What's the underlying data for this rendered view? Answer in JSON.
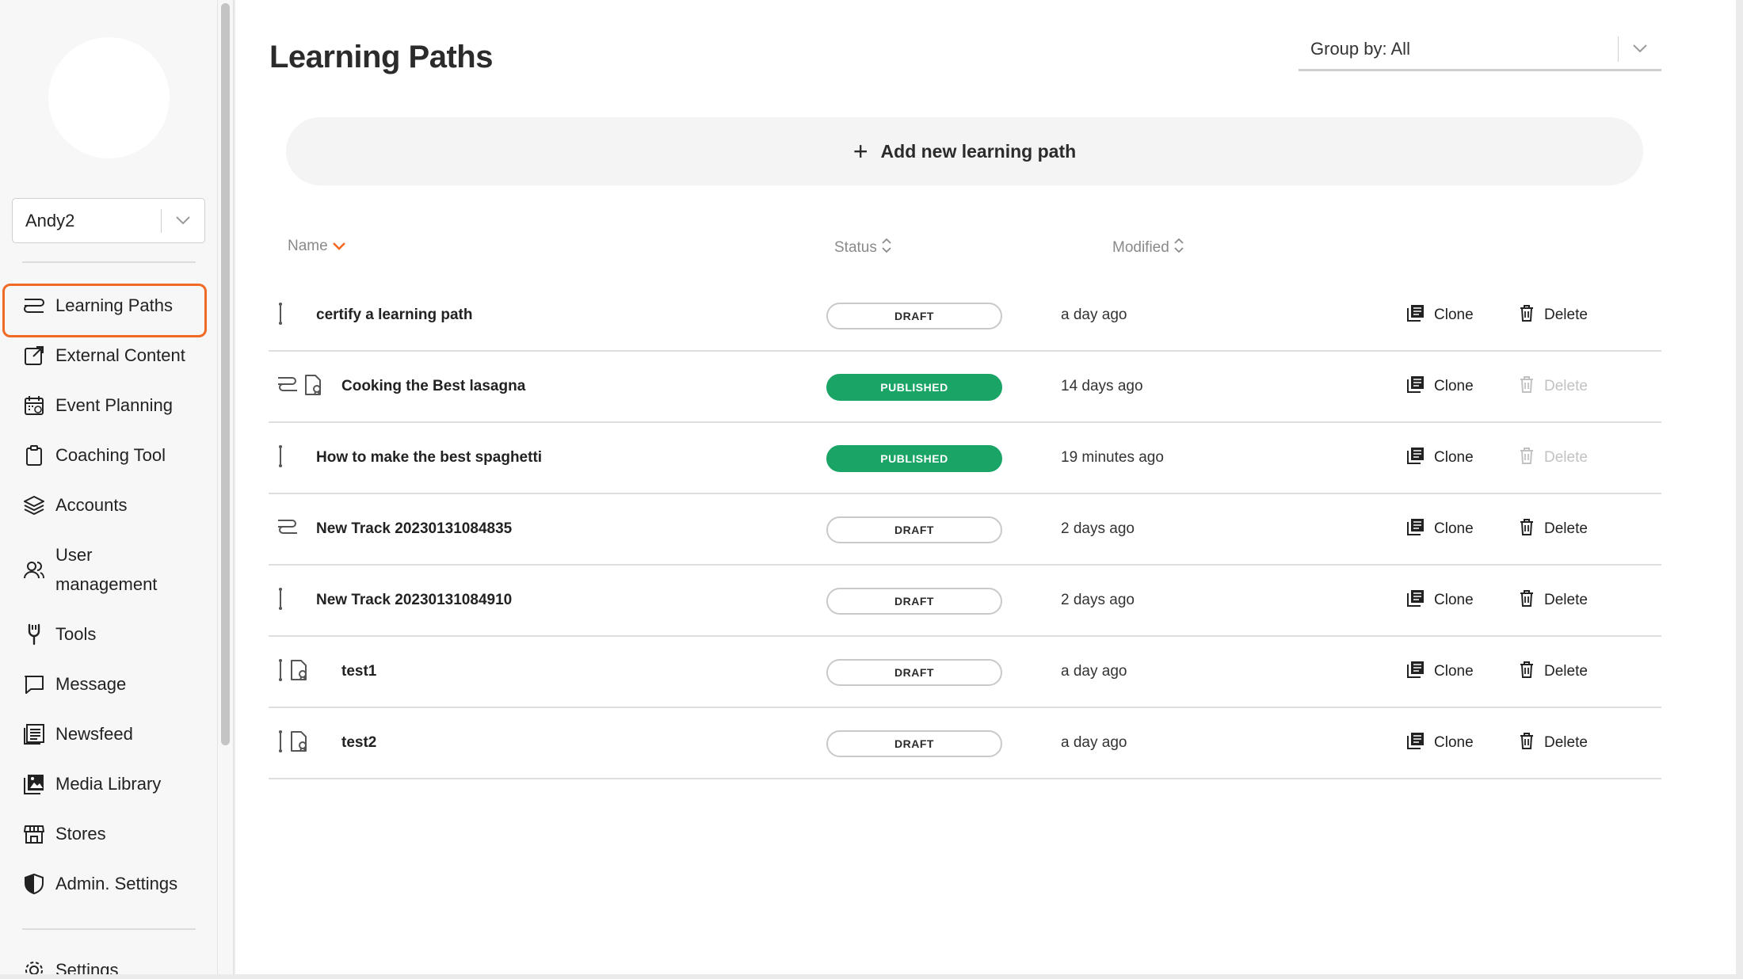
{
  "sidebar": {
    "user_select": {
      "value": "Andy2"
    },
    "items": [
      {
        "label": "Learning Paths",
        "icon": "learning-paths-icon"
      },
      {
        "label": "External Content",
        "icon": "external-link-icon"
      },
      {
        "label": "Event Planning",
        "icon": "calendar-icon"
      },
      {
        "label": "Coaching Tool",
        "icon": "clipboard-icon"
      },
      {
        "label": "Accounts",
        "icon": "layers-icon"
      },
      {
        "label_line1": "User",
        "label_line2": "management",
        "icon": "users-icon"
      },
      {
        "label": "Tools",
        "icon": "tools-icon"
      },
      {
        "label": "Message",
        "icon": "message-icon"
      },
      {
        "label": "Newsfeed",
        "icon": "newsfeed-icon"
      },
      {
        "label": "Media Library",
        "icon": "media-library-icon"
      },
      {
        "label": "Stores",
        "icon": "store-icon"
      },
      {
        "label": "Admin. Settings",
        "icon": "shield-icon"
      },
      {
        "label": "Settings",
        "icon": "gear-icon"
      }
    ]
  },
  "main": {
    "title": "Learning Paths",
    "group_by": "Group by: All",
    "add_button": "Add new learning path",
    "columns": {
      "name": "Name",
      "status": "Status",
      "modified": "Modified"
    },
    "actions": {
      "clone": "Clone",
      "delete": "Delete"
    },
    "rows": [
      {
        "name": "certify a learning path",
        "status": "DRAFT",
        "modified": "a day ago",
        "icons": [
          "vertical-path-icon"
        ],
        "delete_enabled": true
      },
      {
        "name": "Cooking the Best lasagna",
        "status": "PUBLISHED",
        "modified": "14 days ago",
        "icons": [
          "branch-path-icon",
          "certificate-icon"
        ],
        "delete_enabled": false
      },
      {
        "name": "How to make the best spaghetti",
        "status": "PUBLISHED",
        "modified": "19 minutes ago",
        "icons": [
          "vertical-path-icon"
        ],
        "delete_enabled": false
      },
      {
        "name": "New Track 20230131084835",
        "status": "DRAFT",
        "modified": "2 days ago",
        "icons": [
          "branch-path-icon"
        ],
        "delete_enabled": true
      },
      {
        "name": "New Track 20230131084910",
        "status": "DRAFT",
        "modified": "2 days ago",
        "icons": [
          "vertical-path-icon"
        ],
        "delete_enabled": true
      },
      {
        "name": "test1",
        "status": "DRAFT",
        "modified": "a day ago",
        "icons": [
          "vertical-path-icon",
          "certificate-icon"
        ],
        "delete_enabled": true
      },
      {
        "name": "test2",
        "status": "DRAFT",
        "modified": "a day ago",
        "icons": [
          "vertical-path-icon",
          "certificate-icon"
        ],
        "delete_enabled": true
      }
    ]
  },
  "colors": {
    "accent": "#f06a25",
    "published": "#1aa566"
  }
}
